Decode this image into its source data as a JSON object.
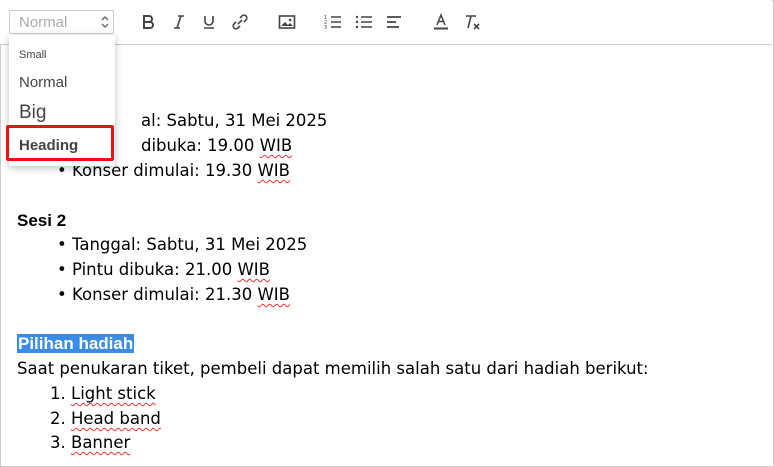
{
  "toolbar": {
    "size_value": "Normal",
    "buttons": [
      "bold-icon",
      "italic-icon",
      "underline-icon",
      "link-icon",
      "image-icon",
      "ordered-list-icon",
      "bullet-list-icon",
      "align-icon",
      "text-color-icon",
      "clear-format-icon"
    ]
  },
  "dropdown": {
    "options": [
      "Small",
      "Normal",
      "Big",
      "Heading"
    ],
    "highlighted": "Heading"
  },
  "content": {
    "line1_tail": "al: Sabtu, 31 Mei 2025",
    "line2_tail": "dibuka: 19.00",
    "line2_wib": "WIB",
    "line3_text": "Konser dimulai: 19.30",
    "line3_wib": "WIB",
    "sesi2_title": "Sesi 2",
    "sesi2_items": [
      {
        "text": "Tanggal: Sabtu, 31 Mei 2025",
        "wib": ""
      },
      {
        "text": "Pintu dibuka: 21.00",
        "wib": "WIB"
      },
      {
        "text": "Konser dimulai: 21.30",
        "wib": "WIB"
      }
    ],
    "hadiah_title": "Pilihan hadiah",
    "hadiah_intro": "Saat penukaran tiket, pembeli dapat memilih salah satu dari hadiah berikut:",
    "hadiah_items": [
      "Light stick",
      "Head band",
      "Banner"
    ],
    "bullet": "•",
    "numbers": [
      "1.",
      "2.",
      "3."
    ]
  },
  "colors": {
    "selection": "#3b8ce6",
    "highlight_border": "#e11111",
    "spellcheck": "#e33333"
  }
}
